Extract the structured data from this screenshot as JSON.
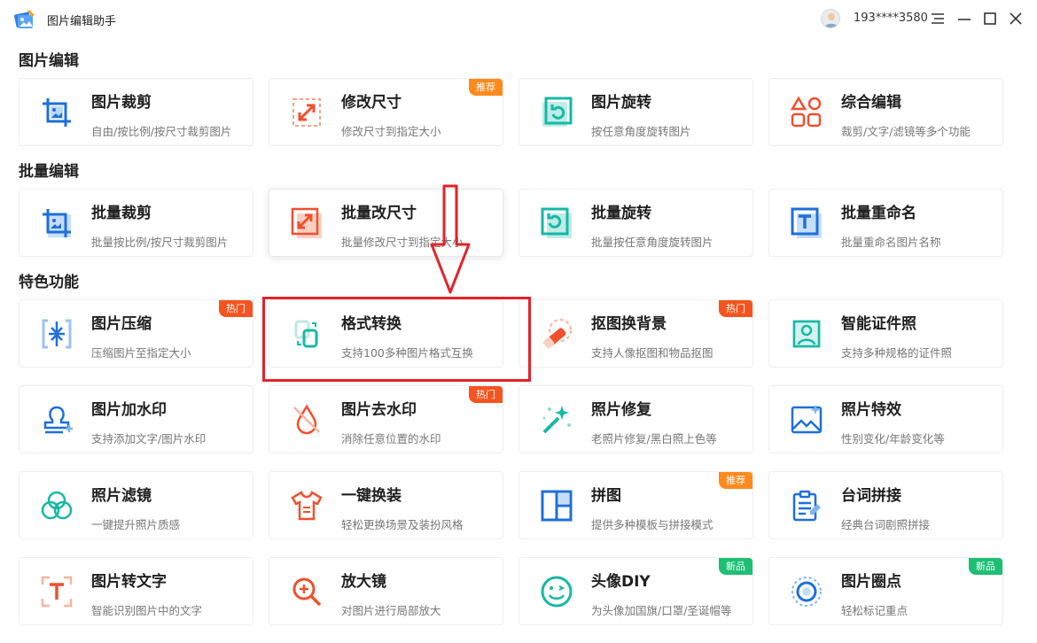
{
  "app": {
    "title": "图片编辑助手"
  },
  "user": {
    "name": "193****3580"
  },
  "colors": {
    "accent": "#1e88e5",
    "badge_hot": "#f5541f",
    "badge_rec": "#ff8a1c",
    "badge_new": "#1cbf73",
    "highlight": "#e1232b"
  },
  "sections": [
    {
      "title": "图片编辑",
      "cards": [
        {
          "title": "图片裁剪",
          "desc": "自由/按比例/按尺寸裁剪图片",
          "icon": "crop-icon"
        },
        {
          "title": "修改尺寸",
          "desc": "修改尺寸到指定大小",
          "icon": "resize-icon",
          "badge": "推荐"
        },
        {
          "title": "图片旋转",
          "desc": "按任意角度旋转图片",
          "icon": "rotate-icon"
        },
        {
          "title": "综合编辑",
          "desc": "裁剪/文字/滤镜等多个功能",
          "icon": "shapes-icon"
        }
      ]
    },
    {
      "title": "批量编辑",
      "cards": [
        {
          "title": "批量裁剪",
          "desc": "批量按比例/按尺寸裁剪图片",
          "icon": "batch-crop-icon"
        },
        {
          "title": "批量改尺寸",
          "desc": "批量修改尺寸到指定大小",
          "icon": "batch-resize-icon"
        },
        {
          "title": "批量旋转",
          "desc": "批量按任意角度旋转图片",
          "icon": "batch-rotate-icon"
        },
        {
          "title": "批量重命名",
          "desc": "批量重命名图片名称",
          "icon": "rename-icon"
        }
      ]
    },
    {
      "title": "特色功能",
      "cards": [
        {
          "title": "图片压缩",
          "desc": "压缩图片至指定大小",
          "icon": "compress-icon",
          "badge": "热门"
        },
        {
          "title": "格式转换",
          "desc": "支持100多种图片格式互换",
          "icon": "convert-icon"
        },
        {
          "title": "抠图换背景",
          "desc": "支持人像抠图和物品抠图",
          "icon": "eraser-icon",
          "badge": "热门"
        },
        {
          "title": "智能证件照",
          "desc": "支持多种规格的证件照",
          "icon": "id-photo-icon"
        },
        {
          "title": "图片加水印",
          "desc": "支持添加文字/图片水印",
          "icon": "stamp-icon"
        },
        {
          "title": "图片去水印",
          "desc": "消除任意位置的水印",
          "icon": "remove-watermark-icon",
          "badge": "热门"
        },
        {
          "title": "照片修复",
          "desc": "老照片修复/黑白照上色等",
          "icon": "magic-wand-icon"
        },
        {
          "title": "照片特效",
          "desc": "性别变化/年龄变化等",
          "icon": "effect-icon"
        },
        {
          "title": "照片滤镜",
          "desc": "一键提升照片质感",
          "icon": "filter-icon"
        },
        {
          "title": "一键换装",
          "desc": "轻松更换场景及装扮风格",
          "icon": "shirt-icon"
        },
        {
          "title": "拼图",
          "desc": "提供多种模板与拼接模式",
          "icon": "collage-icon",
          "badge": "推荐"
        },
        {
          "title": "台词拼接",
          "desc": "经典台词剧照拼接",
          "icon": "clipboard-icon"
        },
        {
          "title": "图片转文字",
          "desc": "智能识别图片中的文字",
          "icon": "ocr-icon"
        },
        {
          "title": "放大镜",
          "desc": "对图片进行局部放大",
          "icon": "magnifier-icon"
        },
        {
          "title": "头像DIY",
          "desc": "为头像加国旗/口罩/圣诞帽等",
          "icon": "smiley-icon",
          "badge": "新品"
        },
        {
          "title": "图片圈点",
          "desc": "轻松标记重点",
          "icon": "circle-mark-icon",
          "badge": "新品"
        }
      ]
    }
  ]
}
